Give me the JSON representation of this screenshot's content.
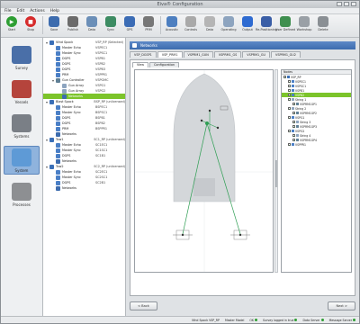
{
  "window": {
    "title": "Eiva® Configuration"
  },
  "menu": [
    "File",
    "Edit",
    "Actions",
    "Help"
  ],
  "toolbar": [
    {
      "label": "Start",
      "icon": "start-icon",
      "color": "#2e9e33"
    },
    {
      "label": "Stop",
      "icon": "stop-icon",
      "color": "#d62b2b"
    },
    {
      "label": "Save",
      "icon": "save-icon",
      "color": "#3d6cae"
    },
    {
      "label": "Publish",
      "icon": "publish-icon",
      "color": "#6b6b6b"
    },
    {
      "label": "Data",
      "icon": "data-icon",
      "color": "#6b8fb8"
    },
    {
      "label": "Sync",
      "icon": "sync-icon",
      "color": "#3d8c63"
    },
    {
      "label": "GPS",
      "icon": "gps-icon",
      "color": "#3b6cb5"
    },
    {
      "label": "PRM",
      "icon": "prm-icon",
      "color": "#777777"
    },
    {
      "label": "Acoustic",
      "icon": "acoustic-icon",
      "color": "#4d7fc0"
    },
    {
      "label": "Controls",
      "icon": "controls-icon",
      "color": "#a9a9a9"
    },
    {
      "label": "Data",
      "icon": "data2-icon",
      "color": "#b5b5b5"
    },
    {
      "label": "Operating",
      "icon": "operating-icon",
      "color": "#8da4bf"
    },
    {
      "label": "Output",
      "icon": "output-icon",
      "color": "#2e6bd1"
    },
    {
      "label": "Re-Positioning",
      "icon": "repositioning-icon",
      "color": "#3a5ea6"
    },
    {
      "label": "User Defined",
      "icon": "user-defined-icon",
      "color": "#3f8f4f"
    },
    {
      "label": "Workshop",
      "icon": "workshop-icon",
      "color": "#9aa0a6"
    },
    {
      "label": "Delete",
      "icon": "delete-icon",
      "color": "#8a8f94"
    }
  ],
  "nav": [
    {
      "label": "Survey",
      "icon": "survey-icon"
    },
    {
      "label": "Vessels",
      "icon": "vessels-icon"
    },
    {
      "label": "Systems",
      "icon": "systems-icon"
    },
    {
      "label": "System",
      "icon": "system-icon",
      "active": true
    },
    {
      "label": "Processes",
      "icon": "processes-icon"
    }
  ],
  "tree": [
    {
      "indent": 0,
      "exp": "▾",
      "label": "Vthd Spock",
      "label2": "VSP_RP (Selected)",
      "color": "#3a6fb7"
    },
    {
      "indent": 1,
      "exp": "",
      "label": "Master Echo",
      "label2": "VSPEC1",
      "color": "#4a7fc6"
    },
    {
      "indent": 1,
      "exp": "",
      "label": "Master Sync",
      "label2": "VSPSC1",
      "color": "#4a7fc6"
    },
    {
      "indent": 1,
      "exp": "",
      "label": "DGPS",
      "label2": "VSPB1",
      "color": "#4a7fc6"
    },
    {
      "indent": 1,
      "exp": "",
      "label": "DGPS",
      "label2": "VSPB2",
      "color": "#4a7fc6"
    },
    {
      "indent": 1,
      "exp": "",
      "label": "DGPS",
      "label2": "VSPB3",
      "color": "#4a7fc6"
    },
    {
      "indent": 1,
      "exp": "",
      "label": "PRM",
      "label2": "VSPPR1",
      "color": "#4a7fc6"
    },
    {
      "indent": 1,
      "exp": "▾",
      "label": "Gun Controller",
      "label2": "VSPGMC",
      "color": "#5f7f95"
    },
    {
      "indent": 2,
      "exp": "",
      "label": "Gun Array",
      "label2": "VSPG1",
      "color": "#8da4bf"
    },
    {
      "indent": 2,
      "exp": "",
      "label": "Gun Array",
      "label2": "VSPG2",
      "color": "#8da4bf"
    },
    {
      "indent": 2,
      "exp": "",
      "label": "Networks",
      "label2": "",
      "color": "#3d6cae",
      "selected": true
    },
    {
      "indent": 0,
      "exp": "▾",
      "label": "Blast Spock",
      "label2": "BSP_RP (unlicensed)",
      "color": "#3a6fb7"
    },
    {
      "indent": 1,
      "exp": "",
      "label": "Master Echo",
      "label2": "BSPEC1",
      "color": "#4a7fc6"
    },
    {
      "indent": 1,
      "exp": "",
      "label": "Master Sync",
      "label2": "BSPSC1",
      "color": "#4a7fc6"
    },
    {
      "indent": 1,
      "exp": "",
      "label": "DGPS",
      "label2": "BSPB1",
      "color": "#4a7fc6"
    },
    {
      "indent": 1,
      "exp": "",
      "label": "DGPS",
      "label2": "BSPB2",
      "color": "#4a7fc6"
    },
    {
      "indent": 1,
      "exp": "",
      "label": "PRM",
      "label2": "BSPPR1",
      "color": "#4a7fc6"
    },
    {
      "indent": 1,
      "exp": "",
      "label": "Networks",
      "label2": "",
      "color": "#3d6cae"
    },
    {
      "indent": 0,
      "exp": "▾",
      "label": "Tow1",
      "label2": "SC1_RP (unlicensed)",
      "color": "#3a6fb7"
    },
    {
      "indent": 1,
      "exp": "",
      "label": "Master Echo",
      "label2": "SC1EC1",
      "color": "#4a7fc6"
    },
    {
      "indent": 1,
      "exp": "",
      "label": "Master Sync",
      "label2": "SC1SC1",
      "color": "#4a7fc6"
    },
    {
      "indent": 1,
      "exp": "",
      "label": "DGPS",
      "label2": "SC1B1",
      "color": "#4a7fc6"
    },
    {
      "indent": 1,
      "exp": "",
      "label": "Networks",
      "label2": "",
      "color": "#3d6cae"
    },
    {
      "indent": 0,
      "exp": "▾",
      "label": "Tow2",
      "label2": "SC2_RP (unlicensed)",
      "color": "#3a6fb7"
    },
    {
      "indent": 1,
      "exp": "",
      "label": "Master Echo",
      "label2": "SC2EC1",
      "color": "#4a7fc6"
    },
    {
      "indent": 1,
      "exp": "",
      "label": "Master Sync",
      "label2": "SC2SC1",
      "color": "#4a7fc6"
    },
    {
      "indent": 1,
      "exp": "",
      "label": "DGPS",
      "label2": "SC2B1",
      "color": "#4a7fc6"
    },
    {
      "indent": 1,
      "exp": "",
      "label": "Networks",
      "label2": "",
      "color": "#3d6cae"
    }
  ],
  "main": {
    "path": "Networks",
    "tabs": [
      "VSP_DGSP1",
      "VSP_PRM1",
      "VSPRM1_GUN",
      "VSPRM1_GS",
      "VSPRM1_GU",
      "VSPRM1_GU2"
    ],
    "active_tab": 1,
    "subtabs": [
      "View",
      "Configuration"
    ],
    "active_subtab": 0,
    "node_label": "Node",
    "right_header": "Nodes",
    "right_tree": [
      {
        "indent": 0,
        "label": "VSP_RP",
        "checked": true,
        "color": "#3a6fb7"
      },
      {
        "indent": 1,
        "label": "VSPEC1",
        "checked": true,
        "color": "#4a7fc6"
      },
      {
        "indent": 1,
        "label": "VSPSC1",
        "checked": true,
        "color": "#4a7fc6"
      },
      {
        "indent": 1,
        "label": "VSPB1",
        "checked": true,
        "color": "#4a7fc6"
      },
      {
        "indent": 1,
        "label": "VSPB2",
        "checked": true,
        "color": "#4a7fc6",
        "selected": true
      },
      {
        "indent": 1,
        "label": "String 1",
        "checked": true,
        "color": "#8da4bf"
      },
      {
        "indent": 2,
        "label": "VSPRM1GP1",
        "checked": true,
        "color": "#5f7f95"
      },
      {
        "indent": 1,
        "label": "String 2",
        "checked": true,
        "color": "#8da4bf"
      },
      {
        "indent": 2,
        "label": "VSPRM1GP2",
        "checked": true,
        "color": "#5f7f95"
      },
      {
        "indent": 1,
        "label": "VSPG1",
        "checked": true,
        "color": "#4a7fc6"
      },
      {
        "indent": 2,
        "label": "String 3",
        "checked": true,
        "color": "#8da4bf"
      },
      {
        "indent": 2,
        "label": "VSPRM1GP3",
        "checked": true,
        "color": "#5f7f95"
      },
      {
        "indent": 1,
        "label": "VSPG2",
        "checked": true,
        "color": "#4a7fc6"
      },
      {
        "indent": 2,
        "label": "String 4",
        "checked": true,
        "color": "#8da4bf"
      },
      {
        "indent": 2,
        "label": "VSPRM1GP4",
        "checked": true,
        "color": "#5f7f95"
      },
      {
        "indent": 1,
        "label": "VSPPR1",
        "checked": true,
        "color": "#4a7fc6"
      }
    ],
    "back_label": "< Back",
    "next_label": "Next >"
  },
  "status": {
    "items": [
      {
        "label": "Vthd Spock VSP_RP",
        "dot": ""
      },
      {
        "label": "Master Model",
        "dot": ""
      },
      {
        "label": "OK",
        "dot": "#2e9e33"
      },
      {
        "label": "Survey logged in true",
        "dot": "#2e9e33"
      },
      {
        "label": "Data Server",
        "dot": "#2e9e33"
      },
      {
        "label": "Message Server",
        "dot": "#2e9e33"
      }
    ]
  }
}
